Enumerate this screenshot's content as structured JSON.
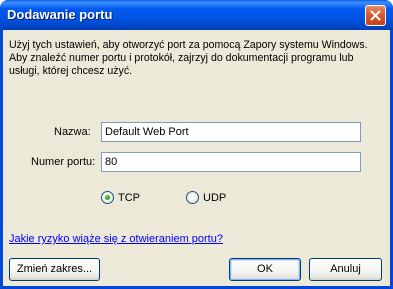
{
  "window": {
    "title": "Dodawanie portu"
  },
  "description": "Użyj tych ustawień, aby otworzyć port za pomocą Zapory systemu Windows. Aby znaleźć numer portu i protokół, zajrzyj do dokumentacji programu lub usługi, której chcesz użyć.",
  "form": {
    "name_label": "Nazwa:",
    "name_value": "Default Web Port",
    "port_label": "Numer portu:",
    "port_value": "80",
    "protocol": {
      "tcp_label": "TCP",
      "udp_label": "UDP",
      "selected": "TCP"
    }
  },
  "risk_link": "Jakie ryzyko wiąże się z otwieraniem portu?",
  "buttons": {
    "change_scope": "Zmień zakres...",
    "ok": "OK",
    "cancel": "Anuluj"
  },
  "colors": {
    "titlebar": "#0058ee",
    "dialog_background": "#ece9d8",
    "close_button": "#d85a30",
    "link": "#0000ff"
  }
}
